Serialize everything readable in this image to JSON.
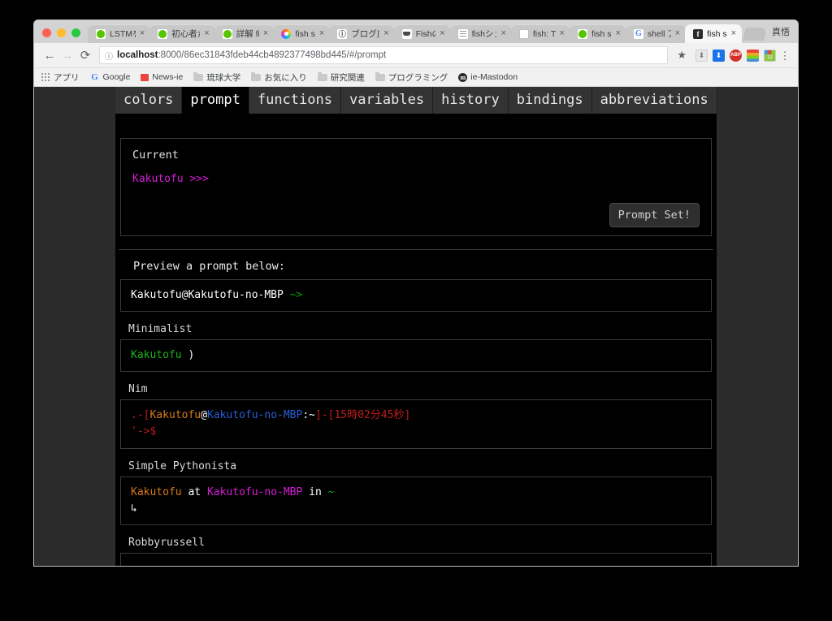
{
  "browser": {
    "traffic_lights": [
      "close",
      "minimize",
      "zoom"
    ],
    "tabs": [
      {
        "title": "LSTMを",
        "favicon": "qiita-icon",
        "active": false
      },
      {
        "title": "初心者か",
        "favicon": "qiita-icon",
        "active": false
      },
      {
        "title": "詳解 fis",
        "favicon": "qiita-icon",
        "active": false
      },
      {
        "title": "fish sh",
        "favicon": "color-ring-icon",
        "active": false
      },
      {
        "title": "ブログ庄",
        "favicon": "info-icon",
        "active": false
      },
      {
        "title": "Fishの",
        "favicon": "cup-icon",
        "active": false
      },
      {
        "title": "fishシェ",
        "favicon": "lines-icon",
        "active": false
      },
      {
        "title": "fish: Tu",
        "favicon": "document-icon",
        "active": false
      },
      {
        "title": "fish sh",
        "favicon": "qiita-icon",
        "active": false
      },
      {
        "title": "shell ア",
        "favicon": "google-icon",
        "active": false
      },
      {
        "title": "fish sh",
        "favicon": "f-icon",
        "active": true
      }
    ],
    "close_label": "×",
    "profile_name": "真悟",
    "nav": {
      "back": "←",
      "forward": "→",
      "reload": "C"
    },
    "omnibox": {
      "info_icon": "info-circle-icon",
      "host": "localhost",
      "rest": ":8000/86ec31843fdeb44cb4892377498bd445/#/prompt",
      "star_icon": "★"
    },
    "extensions": [
      {
        "name": "download-gray-icon",
        "label": "⬇"
      },
      {
        "name": "download-blue-icon",
        "label": "⬇"
      },
      {
        "name": "adblock-icon",
        "label": "ABP"
      },
      {
        "name": "color-bars-icon",
        "label": ""
      },
      {
        "name": "calendar-icon",
        "label": "12"
      }
    ],
    "menu_icon": "⋮",
    "bookmarks": [
      {
        "label": "アプリ",
        "icon": "apps-grid-icon"
      },
      {
        "label": "Google",
        "icon": "google-icon"
      },
      {
        "label": "News-ie",
        "icon": "news-icon"
      },
      {
        "label": "琉球大学",
        "icon": "folder-icon"
      },
      {
        "label": "お気に入り",
        "icon": "folder-icon"
      },
      {
        "label": "研究関連",
        "icon": "folder-icon"
      },
      {
        "label": "プログラミング",
        "icon": "folder-icon"
      },
      {
        "label": "ie-Mastodon",
        "icon": "mastodon-icon"
      }
    ]
  },
  "page": {
    "nav_tabs": [
      {
        "label": "colors",
        "active": false
      },
      {
        "label": "prompt",
        "active": true
      },
      {
        "label": "functions",
        "active": false
      },
      {
        "label": "variables",
        "active": false
      },
      {
        "label": "history",
        "active": false
      },
      {
        "label": "bindings",
        "active": false
      },
      {
        "label": "abbreviations",
        "active": false
      }
    ],
    "current": {
      "title": "Current",
      "prompt_text": "Kakutofu >>>",
      "button_label": "Prompt Set!"
    },
    "preview_label": "Preview a prompt below:",
    "samples": [
      {
        "name": "",
        "lines": [
          [
            {
              "text": "Kakutofu@Kakutofu-no-MBP ",
              "color": "white"
            },
            {
              "text": "~>",
              "color": "green"
            }
          ]
        ]
      },
      {
        "name": "Minimalist",
        "lines": [
          [
            {
              "text": "Kakutofu",
              "color": "green-b"
            },
            {
              "text": " )",
              "color": "white"
            }
          ]
        ]
      },
      {
        "name": "Nim",
        "lines": [
          [
            {
              "text": ".-[",
              "color": "red"
            },
            {
              "text": "Kakutofu",
              "color": "orange"
            },
            {
              "text": "@",
              "color": "white"
            },
            {
              "text": "Kakutofu-no-MBP",
              "color": "blue"
            },
            {
              "text": ":~",
              "color": "white"
            },
            {
              "text": "]-[",
              "color": "red"
            },
            {
              "text": "15時02分45秒",
              "color": "red"
            },
            {
              "text": "]",
              "color": "red"
            }
          ],
          [
            {
              "text": "'->$",
              "color": "red"
            }
          ]
        ]
      },
      {
        "name": "Simple Pythonista",
        "lines": [
          [
            {
              "text": "Kakutofu",
              "color": "orange"
            },
            {
              "text": " at ",
              "color": "white"
            },
            {
              "text": "Kakutofu-no-MBP",
              "color": "magenta"
            },
            {
              "text": " in ",
              "color": "white"
            },
            {
              "text": "~",
              "color": "green-b"
            }
          ],
          [
            {
              "text": "↳",
              "color": "white"
            }
          ]
        ]
      },
      {
        "name": "Robbyrussell",
        "lines": [
          [
            {
              "text": "→",
              "color": "red"
            },
            {
              "text": "  ",
              "color": "white"
            },
            {
              "text": "~",
              "color": "cyan"
            }
          ]
        ]
      }
    ]
  }
}
